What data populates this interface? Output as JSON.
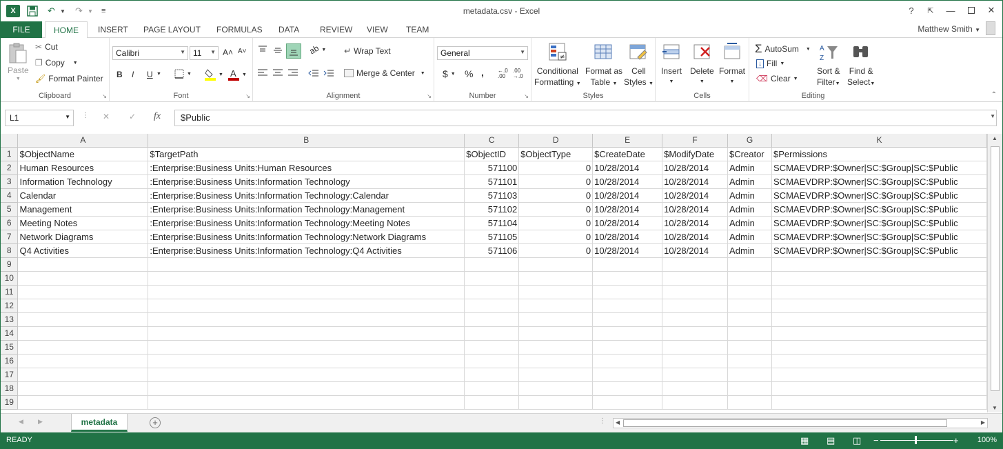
{
  "window": {
    "title": "metadata.csv - Excel",
    "help": "?",
    "minimize": "—",
    "restore": "❏",
    "close": "✕",
    "ribbon_display": "⇱"
  },
  "qat": {
    "app_letter": "X",
    "undo": "↶",
    "redo": "↷",
    "customize": "≡"
  },
  "ribbon_tabs": [
    "FILE",
    "HOME",
    "INSERT",
    "PAGE LAYOUT",
    "FORMULAS",
    "DATA",
    "REVIEW",
    "VIEW",
    "TEAM"
  ],
  "active_tab": "HOME",
  "user": "Matthew Smith",
  "clipboard": {
    "paste": "Paste",
    "cut": "Cut",
    "copy": "Copy",
    "format_painter": "Format Painter",
    "label": "Clipboard"
  },
  "font": {
    "name": "Calibri",
    "size": "11",
    "grow": "A˄",
    "shrink": "A˅",
    "bold": "B",
    "italic": "I",
    "underline": "U",
    "label": "Font"
  },
  "alignment": {
    "wrap_text": "Wrap Text",
    "merge_center": "Merge & Center",
    "label": "Alignment"
  },
  "number": {
    "format": "General",
    "currency": "$",
    "percent": "%",
    "comma": ",",
    "inc_dec": "←.0\n.00",
    "dec_dec": ".00\n→.0",
    "label": "Number"
  },
  "styles": {
    "conditional": "Conditional",
    "conditional2": "Formatting",
    "format_table": "Format as",
    "format_table2": "Table",
    "cell_styles": "Cell",
    "cell_styles2": "Styles",
    "label": "Styles"
  },
  "cells": {
    "insert": "Insert",
    "delete": "Delete",
    "format": "Format",
    "label": "Cells"
  },
  "editing": {
    "autosum": "AutoSum",
    "fill": "Fill",
    "clear": "Clear",
    "sort": "Sort &",
    "sort2": "Filter",
    "find": "Find &",
    "find2": "Select",
    "label": "Editing"
  },
  "formula_bar": {
    "name_box": "L1",
    "cancel": "✕",
    "enter": "✓",
    "fx": "fx",
    "content": "$Public"
  },
  "columns": [
    "A",
    "B",
    "C",
    "D",
    "E",
    "F",
    "G",
    "K"
  ],
  "rows": [
    [
      "$ObjectName",
      "$TargetPath",
      "$ObjectID",
      "$ObjectType",
      "$CreateDate",
      "$ModifyDate",
      "$Creator",
      "$Permissions"
    ],
    [
      "Human Resources",
      ":Enterprise:Business Units:Human Resources",
      "571100",
      "0",
      "10/28/2014",
      "10/28/2014",
      "Admin",
      "SCMAEVDRP:$Owner|SC:$Group|SC:$Public"
    ],
    [
      "Information Technology",
      ":Enterprise:Business Units:Information Technology",
      "571101",
      "0",
      "10/28/2014",
      "10/28/2014",
      "Admin",
      "SCMAEVDRP:$Owner|SC:$Group|SC:$Public"
    ],
    [
      "Calendar",
      ":Enterprise:Business Units:Information Technology:Calendar",
      "571103",
      "0",
      "10/28/2014",
      "10/28/2014",
      "Admin",
      "SCMAEVDRP:$Owner|SC:$Group|SC:$Public"
    ],
    [
      "Management",
      ":Enterprise:Business Units:Information Technology:Management",
      "571102",
      "0",
      "10/28/2014",
      "10/28/2014",
      "Admin",
      "SCMAEVDRP:$Owner|SC:$Group|SC:$Public"
    ],
    [
      "Meeting Notes",
      ":Enterprise:Business Units:Information Technology:Meeting Notes",
      "571104",
      "0",
      "10/28/2014",
      "10/28/2014",
      "Admin",
      "SCMAEVDRP:$Owner|SC:$Group|SC:$Public"
    ],
    [
      "Network Diagrams",
      ":Enterprise:Business Units:Information Technology:Network Diagrams",
      "571105",
      "0",
      "10/28/2014",
      "10/28/2014",
      "Admin",
      "SCMAEVDRP:$Owner|SC:$Group|SC:$Public"
    ],
    [
      "Q4 Activities",
      ":Enterprise:Business Units:Information Technology:Q4 Activities",
      "571106",
      "0",
      "10/28/2014",
      "10/28/2014",
      "Admin",
      "SCMAEVDRP:$Owner|SC:$Group|SC:$Public"
    ]
  ],
  "row_numbers": [
    "1",
    "2",
    "3",
    "4",
    "5",
    "6",
    "7",
    "8",
    "9",
    "10",
    "11",
    "12",
    "13",
    "14",
    "15",
    "16",
    "17",
    "18",
    "19"
  ],
  "sheet_tab": "metadata",
  "status": "READY",
  "zoom": "100%",
  "colors": {
    "accent": "#217346"
  }
}
